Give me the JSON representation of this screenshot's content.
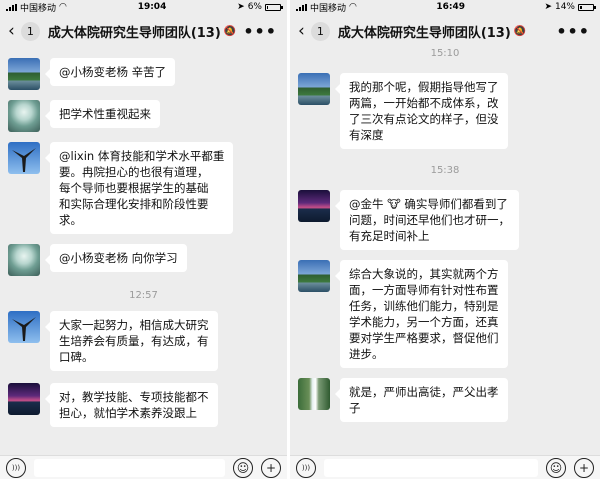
{
  "left_screen": {
    "status": {
      "carrier": "中国移动",
      "time": "19:04",
      "battery": "6%",
      "battery_level": 0.06
    },
    "nav": {
      "unread": "1",
      "title": "成大体院研究生导师团队(13)"
    },
    "messages": [
      {
        "avatar": "landscape-avatar",
        "text": "@小杨变老杨 辛苦了"
      },
      {
        "avatar": "jade-statue-avatar",
        "text": "把学术性重视起来"
      },
      {
        "avatar": "eagle-sculpture-avatar",
        "lines": [
          "@lixin 体育技能和学术水平都重",
          "要。冉院担心的也很有道理，",
          "每个导师也要根据学生的基础",
          "和实际合理化安排和阶段性要",
          "求。"
        ]
      },
      {
        "avatar": "jade-statue-avatar",
        "text": "@小杨变老杨 向你学习"
      },
      {
        "time": "12:57"
      },
      {
        "avatar": "eagle-sculpture-avatar",
        "lines": [
          "大家一起努力，相信成大研究",
          "生培养会有质量，有达成，有",
          "口碑。"
        ]
      },
      {
        "avatar": "night-view-avatar",
        "lines": [
          "对，教学技能、专项技能都不",
          "担心，就怕学术素养没跟上"
        ]
      }
    ]
  },
  "right_screen": {
    "status": {
      "carrier": "中国移动",
      "time": "16:49",
      "battery": "14%",
      "battery_level": 0.14
    },
    "nav": {
      "unread": "1",
      "title": "成大体院研究生导师团队(13)"
    },
    "messages": [
      {
        "time": "15:10"
      },
      {
        "avatar": "landscape-avatar",
        "lines": [
          "我的那个呢，假期指导他写了",
          "两篇，一开始都不成体系，改",
          "了三次有点论文的样子，但没",
          "有深度"
        ]
      },
      {
        "time": "15:38"
      },
      {
        "avatar": "night-view-avatar",
        "lines": [
          "@金牛 🐮 确实导师们都看到了",
          "问题，时间还早他们也才研一，",
          "有充足时间补上"
        ]
      },
      {
        "avatar": "landscape-avatar",
        "lines": [
          "综合大象说的，其实就两个方",
          "面，一方面导师有针对性布置",
          "任务，训练他们能力，特别是",
          "学术能力，另一个方面，还真",
          "要对学生严格要求，督促他们",
          "进步。"
        ]
      },
      {
        "avatar": "waterfall-avatar",
        "lines": [
          "就是，严师出高徒，严父出孝",
          "子"
        ]
      }
    ]
  },
  "icons": {
    "back": "‹",
    "more": "•••",
    "mute": "🔕",
    "voice": ")))",
    "emoji": "☺",
    "plus": "+"
  }
}
